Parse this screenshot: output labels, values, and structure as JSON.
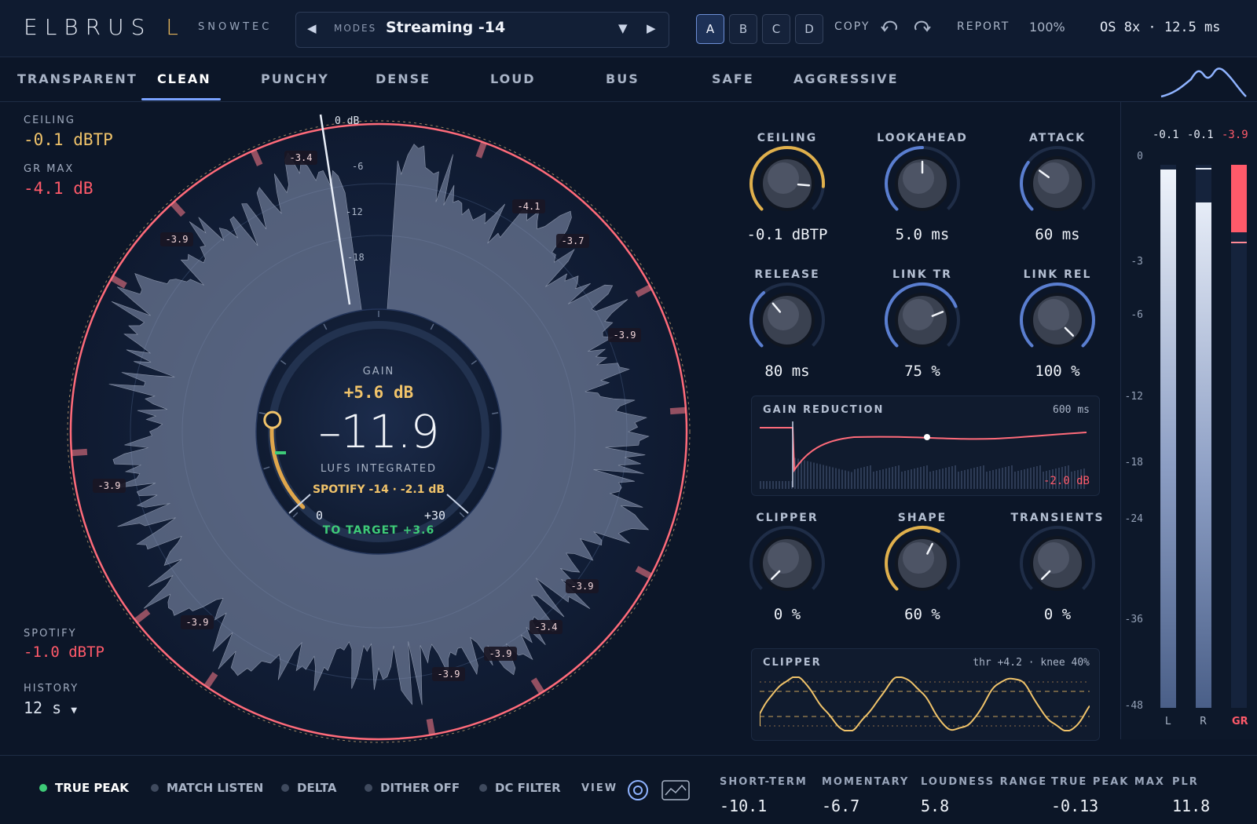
{
  "header": {
    "brand": "ELBRUS",
    "brand_suffix": "L",
    "vendor": "SNOWTEC",
    "modes_label": "MODES",
    "mode_value": "Streaming -14",
    "ab_slots": [
      "A",
      "B",
      "C",
      "D"
    ],
    "active_slot": "A",
    "copy_label": "COPY",
    "report_label": "REPORT",
    "zoom": "100%",
    "os_info": "OS 8x · 12.5 ms"
  },
  "tabs": [
    "TRANSPARENT",
    "CLEAN",
    "PUNCHY",
    "DENSE",
    "LOUD",
    "BUS",
    "SAFE",
    "AGGRESSIVE"
  ],
  "active_tab": "CLEAN",
  "left": {
    "ceiling_label": "CEILING",
    "ceiling_value": "-0.1 dBTP",
    "grmax_label": "GR MAX",
    "grmax_value": "-4.1 dB",
    "spotify_label": "SPOTIFY",
    "spotify_value": "-1.0 dBTP",
    "history_label": "HISTORY",
    "history_value": "12 s"
  },
  "radial": {
    "ring_labels": [
      "0 dB",
      "-6",
      "-12",
      "-18"
    ],
    "gr_tags": [
      "-3.4",
      "-4.1",
      "-3.9",
      "-3.7",
      "-3.9",
      "-3.9",
      "-3.9",
      "-3.9",
      "-3.4",
      "-3.9",
      "-3.9"
    ],
    "gain_label": "GAIN",
    "gain_value": "+5.6 dB",
    "lufs_value": "–11.9",
    "lufs_label": "LUFS INTEGRATED",
    "target_line": "SPOTIFY -14 · -2.1 dB",
    "arc_min": "0",
    "arc_max": "+30",
    "to_target": "TO TARGET +3.6",
    "gain_fraction": 0.19
  },
  "knobs": [
    {
      "label": "CEILING",
      "value": "-0.1 dBTP",
      "fraction": 0.85,
      "accent": "gold"
    },
    {
      "label": "LOOKAHEAD",
      "value": "5.0 ms",
      "fraction": 0.5,
      "accent": "blue"
    },
    {
      "label": "ATTACK",
      "value": "60 ms",
      "fraction": 0.3,
      "accent": "blue"
    },
    {
      "label": "RELEASE",
      "value": "80 ms",
      "fraction": 0.35,
      "accent": "blue"
    },
    {
      "label": "LINK TR",
      "value": "75 %",
      "fraction": 0.75,
      "accent": "blue"
    },
    {
      "label": "LINK REL",
      "value": "100 %",
      "fraction": 1.0,
      "accent": "blue"
    },
    {
      "label": "CLIPPER",
      "value": "0 %",
      "fraction": 0.0,
      "accent": "blue"
    },
    {
      "label": "SHAPE",
      "value": "60 %",
      "fraction": 0.6,
      "accent": "gold"
    },
    {
      "label": "TRANSIENTS",
      "value": "0 %",
      "fraction": 0.0,
      "accent": "blue"
    }
  ],
  "gr_panel": {
    "title": "GAIN REDUCTION",
    "window": "600 ms",
    "readout": "-2.0 dB"
  },
  "clip_panel": {
    "title": "CLIPPER",
    "params": "thr +4.2 · knee 40%"
  },
  "meters": {
    "peaks": [
      "-0.1",
      "-0.1",
      "-3.9"
    ],
    "scale": [
      "0",
      "-3",
      "-6",
      "-12",
      "-18",
      "-24",
      "-36",
      "-48"
    ],
    "channels": [
      "L",
      "R",
      "GR"
    ]
  },
  "footer": {
    "toggles": [
      {
        "label": "TRUE PEAK",
        "on": true
      },
      {
        "label": "MATCH LISTEN",
        "on": false
      },
      {
        "label": "DELTA",
        "on": false
      },
      {
        "label": "DITHER OFF",
        "on": false
      },
      {
        "label": "DC FILTER",
        "on": false
      }
    ],
    "view_label": "VIEW",
    "stats": [
      {
        "label": "SHORT-TERM",
        "value": "-10.1"
      },
      {
        "label": "MOMENTARY",
        "value": "-6.7"
      },
      {
        "label": "LOUDNESS RANGE",
        "value": "5.8"
      },
      {
        "label": "TRUE PEAK MAX",
        "value": "-0.13"
      },
      {
        "label": "PLR",
        "value": "11.8"
      }
    ]
  },
  "colors": {
    "accent_gold": "#e3b45a",
    "accent_red": "#ff5a6a",
    "accent_blue": "#7aa2ff",
    "accent_green": "#3ecb78"
  }
}
